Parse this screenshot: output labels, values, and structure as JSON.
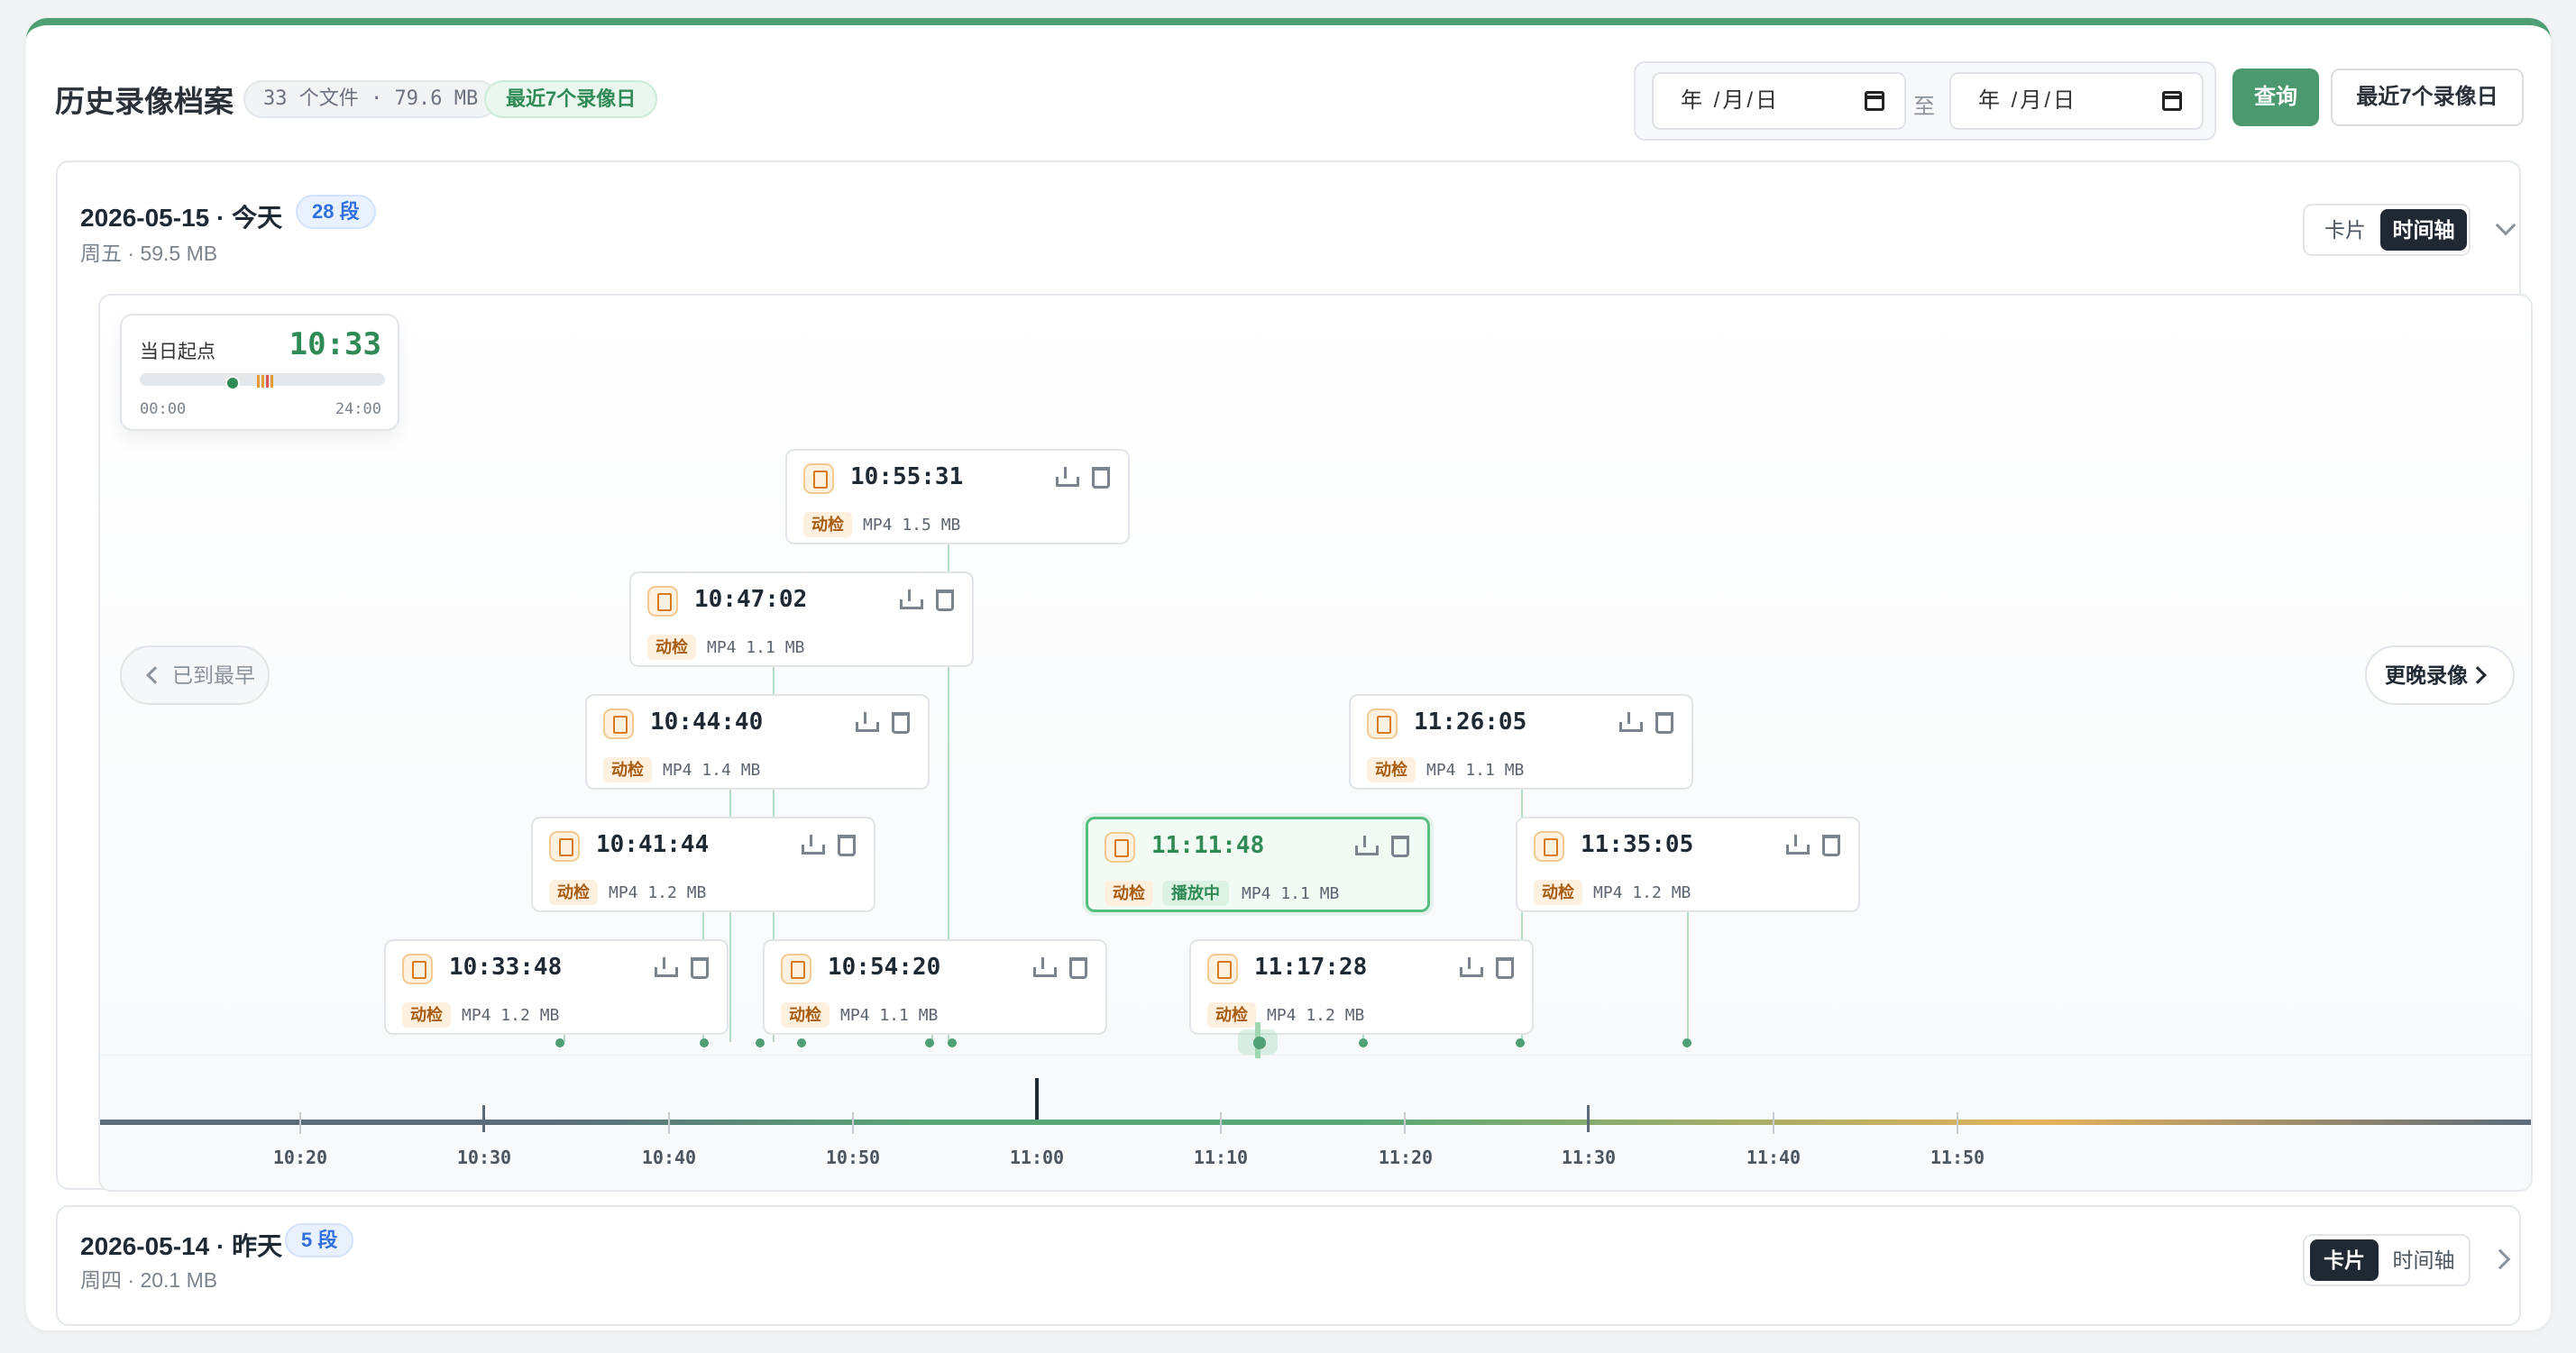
{
  "header": {
    "title": "历史录像档案",
    "file_summary": "33 个文件 · 79.6 MB",
    "range_chip": "最近7个录像日",
    "date_from_placeholder": "年 /月/日",
    "date_to_placeholder": "年 /月/日",
    "to_label": "至",
    "query_button": "查询",
    "recent_button": "最近7个录像日"
  },
  "days": [
    {
      "title": "2026-05-15 · 今天",
      "segments": "28 段",
      "subtitle": "周五 · 59.5 MB",
      "view_options": [
        "卡片",
        "时间轴"
      ],
      "active_view": "时间轴",
      "expanded": true
    },
    {
      "title": "2026-05-14 · 昨天",
      "segments": "5 段",
      "subtitle": "周四 · 20.1 MB",
      "view_options": [
        "卡片",
        "时间轴"
      ],
      "active_view": "卡片",
      "expanded": false
    }
  ],
  "timeline": {
    "day_start": {
      "label": "当日起点",
      "time": "10:33",
      "range_min": "00:00",
      "range_max": "24:00"
    },
    "nav_prev": "已到最早",
    "nav_next": "更晚录像",
    "axis_labels": [
      "10:20",
      "10:30",
      "10:40",
      "10:50",
      "11:00",
      "11:10",
      "11:20",
      "11:30",
      "11:40",
      "11:50"
    ],
    "clips": [
      {
        "time": "10:55:31",
        "tag": "动检",
        "meta": "MP4 1.5 MB",
        "playing": false
      },
      {
        "time": "10:47:02",
        "tag": "动检",
        "meta": "MP4 1.1 MB",
        "playing": false
      },
      {
        "time": "10:44:40",
        "tag": "动检",
        "meta": "MP4 1.4 MB",
        "playing": false
      },
      {
        "time": "11:26:05",
        "tag": "动检",
        "meta": "MP4 1.1 MB",
        "playing": false
      },
      {
        "time": "10:41:44",
        "tag": "动检",
        "meta": "MP4 1.2 MB",
        "playing": false
      },
      {
        "time": "11:11:48",
        "tag": "动检",
        "status": "播放中",
        "meta": "MP4 1.1 MB",
        "playing": true
      },
      {
        "time": "11:35:05",
        "tag": "动检",
        "meta": "MP4 1.2 MB",
        "playing": false
      },
      {
        "time": "10:33:48",
        "tag": "动检",
        "meta": "MP4 1.2 MB",
        "playing": false
      },
      {
        "time": "10:54:20",
        "tag": "动检",
        "meta": "MP4 1.1 MB",
        "playing": false
      },
      {
        "time": "11:17:28",
        "tag": "动检",
        "meta": "MP4 1.2 MB",
        "playing": false
      }
    ]
  },
  "colors": {
    "accent": "#4b9a6f",
    "playing_border": "#56bf7f",
    "tag_bg": "#fdf0de",
    "tag_text": "#a85c12",
    "badge_blue": "#2f6fdf"
  }
}
